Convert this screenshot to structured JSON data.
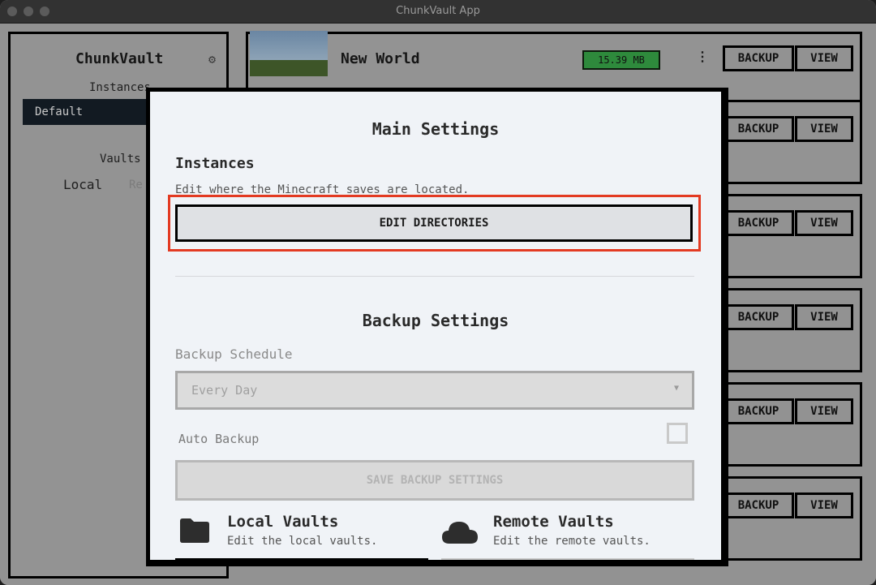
{
  "window": {
    "title": "ChunkVault App"
  },
  "sidebar": {
    "title": "ChunkVault",
    "gear_icon": "gear-icon",
    "instances_label": "Instances",
    "selected_instance": "Default",
    "vaults_label": "Vaults",
    "local_tab": "Local",
    "remote_tab_partial": "Re"
  },
  "worlds": [
    {
      "name": "New World",
      "size": "15.39 MB",
      "backup_label": "BACKUP",
      "view_label": "VIEW"
    },
    {
      "backup_label": "BACKUP",
      "view_label": "VIEW"
    },
    {
      "backup_label": "BACKUP",
      "view_label": "VIEW"
    },
    {
      "backup_label": "BACKUP",
      "view_label": "VIEW"
    },
    {
      "backup_label": "BACKUP",
      "view_label": "VIEW"
    },
    {
      "backup_label": "BACKUP",
      "view_label": "VIEW"
    }
  ],
  "modal": {
    "main_title": "Main Settings",
    "instances_heading": "Instances",
    "instances_desc": "Edit where the Minecraft saves are located.",
    "edit_directories_label": "EDIT DIRECTORIES",
    "backup_title": "Backup Settings",
    "backup_schedule_label": "Backup Schedule",
    "backup_schedule_value": "Every Day",
    "auto_backup_label": "Auto Backup",
    "auto_backup_checked": false,
    "save_backup_label": "SAVE BACKUP SETTINGS",
    "local_vaults_title": "Local Vaults",
    "local_vaults_desc": "Edit the local vaults.",
    "remote_vaults_title": "Remote Vaults",
    "remote_vaults_desc": "Edit the remote vaults."
  },
  "colors": {
    "highlight": "#e33a22",
    "size_badge": "#2e8a3c"
  }
}
